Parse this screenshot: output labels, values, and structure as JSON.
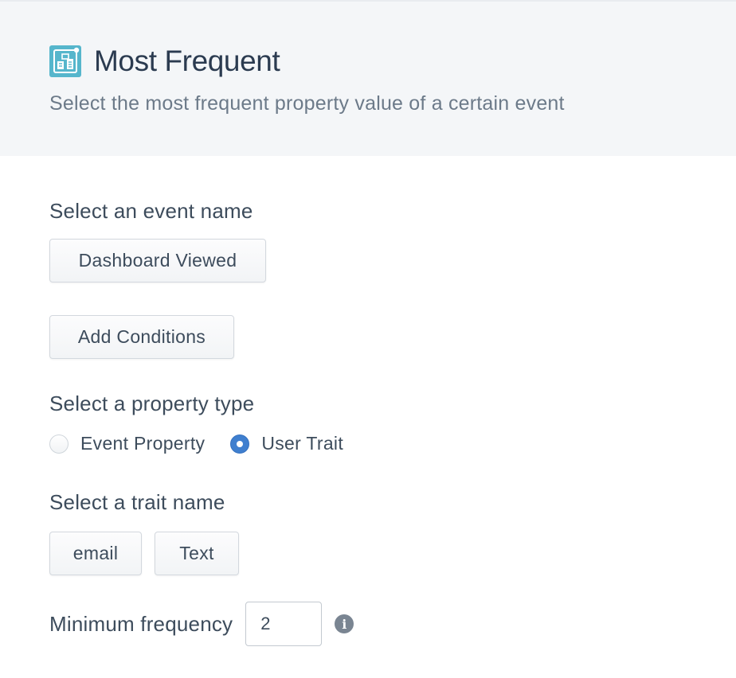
{
  "header": {
    "icon": "building-icon",
    "title": "Most Frequent",
    "subtitle": "Select the most frequent property value of a certain event"
  },
  "event": {
    "label": "Select an event name",
    "selected": "Dashboard Viewed",
    "add_conditions": "Add Conditions"
  },
  "property_type": {
    "label": "Select a property type",
    "options": [
      {
        "label": "Event Property",
        "checked": false
      },
      {
        "label": "User Trait",
        "checked": true
      }
    ]
  },
  "trait": {
    "label": "Select a trait name",
    "name": "email",
    "type": "Text"
  },
  "frequency": {
    "label": "Minimum frequency",
    "value": "2",
    "info_icon": "info-icon"
  },
  "colors": {
    "header_bg": "#f4f6f8",
    "accent": "#3f7fcf",
    "logo": "#56b6cc"
  }
}
